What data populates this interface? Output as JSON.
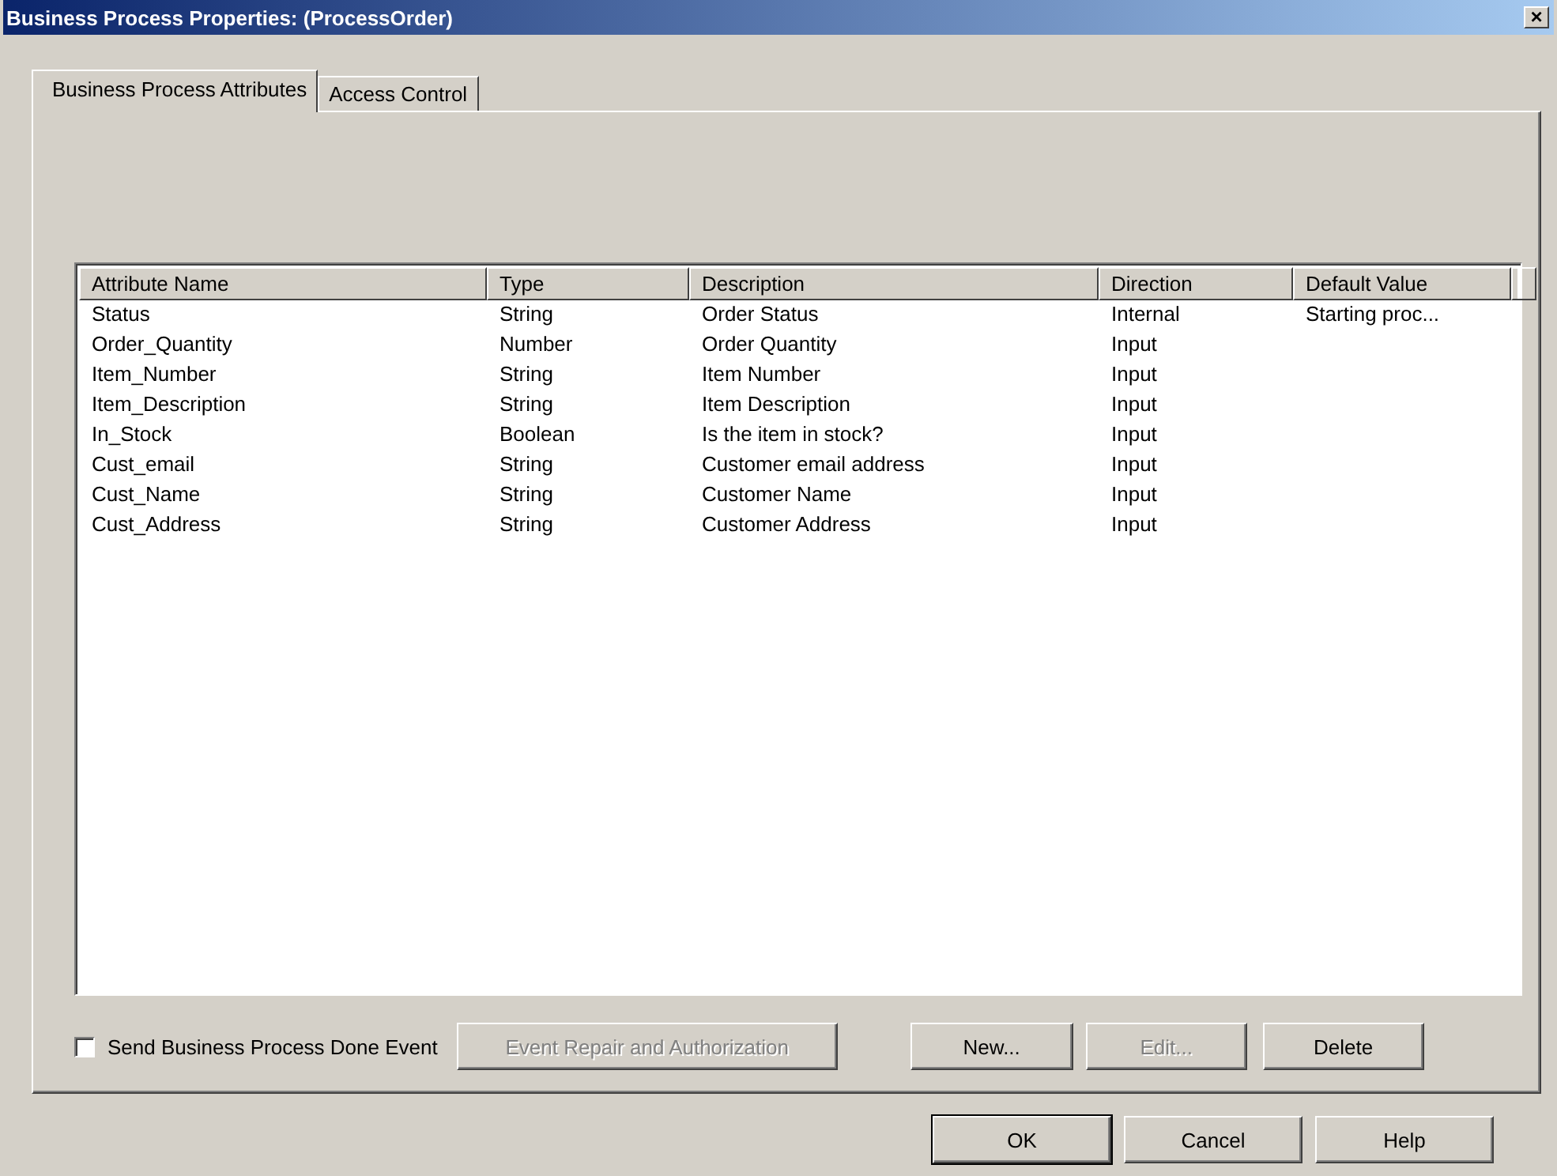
{
  "window": {
    "title": "Business Process Properties: (ProcessOrder)",
    "close": "×"
  },
  "tabs": [
    {
      "label": "Business Process Attributes",
      "selected": true
    },
    {
      "label": "Access Control",
      "selected": false
    }
  ],
  "table": {
    "columns": [
      "Attribute Name",
      "Type",
      "Description",
      "Direction",
      "Default Value"
    ],
    "rows": [
      [
        "Status",
        "String",
        "Order Status",
        "Internal",
        "Starting proc..."
      ],
      [
        "Order_Quantity",
        "Number",
        "Order Quantity",
        "Input",
        ""
      ],
      [
        "Item_Number",
        "String",
        "Item Number",
        "Input",
        ""
      ],
      [
        "Item_Description",
        "String",
        "Item Description",
        "Input",
        ""
      ],
      [
        "In_Stock",
        "Boolean",
        "Is the item in stock?",
        "Input",
        ""
      ],
      [
        "Cust_email",
        "String",
        "Customer email address",
        "Input",
        ""
      ],
      [
        "Cust_Name",
        "String",
        "Customer Name",
        "Input",
        ""
      ],
      [
        "Cust_Address",
        "String",
        "Customer Address",
        "Input",
        ""
      ]
    ]
  },
  "done_event": {
    "label": "Send Business Process Done Event",
    "checked": false
  },
  "panel_buttons": [
    {
      "label": "Event Repair and Authorization",
      "disabled": true
    },
    {
      "label": "New...",
      "disabled": false
    },
    {
      "label": "Edit...",
      "disabled": true
    },
    {
      "label": "Delete",
      "disabled": false
    }
  ],
  "dialog_buttons": [
    {
      "label": "OK",
      "default": true
    },
    {
      "label": "Cancel",
      "default": false
    },
    {
      "label": "Help",
      "default": false
    }
  ]
}
